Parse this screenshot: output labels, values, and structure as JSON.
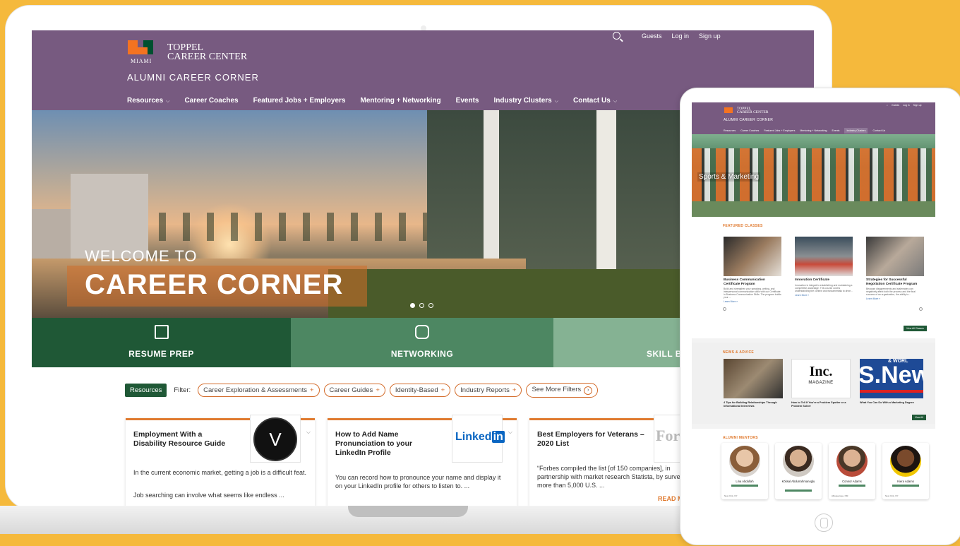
{
  "brand": {
    "logo_miami": "MIAMI",
    "logo_line1": "TOPPEL",
    "logo_line2": "CAREER CENTER",
    "site_subtitle": "ALUMNI CAREER CORNER",
    "colors": {
      "header_purple": "#775a80",
      "green_dark": "#1f5836",
      "orange": "#e07a2f"
    }
  },
  "utility_nav": [
    "Guests",
    "Log in",
    "Sign up"
  ],
  "main_nav": [
    {
      "label": "Resources",
      "dropdown": true
    },
    {
      "label": "Career Coaches",
      "dropdown": false
    },
    {
      "label": "Featured Jobs + Employers",
      "dropdown": false
    },
    {
      "label": "Mentoring + Networking",
      "dropdown": false
    },
    {
      "label": "Events",
      "dropdown": false
    },
    {
      "label": "Industry Clusters",
      "dropdown": true
    },
    {
      "label": "Contact Us",
      "dropdown": true
    }
  ],
  "hero": {
    "welcome": "WELCOME TO",
    "title": "CAREER CORNER",
    "slides": 3,
    "active_slide": 1
  },
  "tiles": [
    {
      "label": "RESUME PREP",
      "icon": "document-icon"
    },
    {
      "label": "NETWORKING",
      "icon": "chat-bubble-icon"
    },
    {
      "label": "SKILL BU",
      "icon": "grid-icon"
    }
  ],
  "filters": {
    "resources_button": "Resources",
    "label": "Filter:",
    "chips": [
      "Career Exploration & Assessments",
      "Career Guides",
      "Identity-Based",
      "Industry Reports"
    ],
    "more": "See More Filters"
  },
  "cards": [
    {
      "title": "Employment With a Disability Resource Guide",
      "body": "In the current economic market, getting a job is a difficult feat.",
      "body2": "Job searching can involve what seems like endless ...",
      "logo": "V"
    },
    {
      "title": "How to Add Name Pronunciation to your LinkedIn Profile",
      "body": "You can record how to pronounce your name and display it on your LinkedIn profile for others to listen to. ...",
      "logo_text": "Linked",
      "logo_in": "in"
    },
    {
      "title": "Best Employers for Veterans – 2020 List",
      "body": "“Forbes compiled the list [of 150 companies], in partnership with market research Statista, by surveying more than 5,000 U.S. ...",
      "logo": "Forb"
    }
  ],
  "read_more": "READ MO",
  "tablet": {
    "logo_line1": "TOPPEL",
    "logo_line2": "CAREER CENTER",
    "subtitle": "ALUMNI CAREER CORNER",
    "utility": [
      "Guests",
      "Log in",
      "Sign up"
    ],
    "nav": [
      "Resources",
      "Career Coaches",
      "Featured Jobs + Employers",
      "Mentoring + Networking",
      "Events",
      "Industry Clusters",
      "Contact Us"
    ],
    "active_nav": "Industry Clusters",
    "hero_label": "Sports & Marketing",
    "featured_title": "FEATURED CLASSES",
    "classes": [
      {
        "name": "Business Communication Certificate Program",
        "desc": "Build and strengthen your speaking, writing, and interpersonal communication skills with our Certificate in Business Communication Skills. The program builds your ...",
        "more": "Learn More »"
      },
      {
        "name": "Innovation Certificate",
        "desc": "Innovation is integral to establishing and maintaining a competitive advantage. This course covers understanding the context and fundamentals to drive...",
        "more": "Learn More »"
      },
      {
        "name": "Strategies for Successful Negotiation Certificate Program",
        "desc": "Because disagreements and stalemates can negatively affect both the process and the final success of an organization, the ability to...",
        "more": "Learn More »"
      }
    ],
    "view_classes": "View All Classes",
    "news_title": "NEWS & ADVICE",
    "news": [
      {
        "caption": "4 Tips for Building Relationships Through Informational Interviews"
      },
      {
        "caption": "How to Tell If You're a Problem Spotter or a Problem Solver",
        "logo": "Inc.",
        "logo_sub": "MAGAZINE"
      },
      {
        "caption": "What You Can Do With a Marketing Degree",
        "logo": "S.New",
        "logo_top": "& WORL"
      }
    ],
    "view_news": "View All",
    "mentors_title": "ALUMNI MENTORS",
    "mentors": [
      {
        "name": "Lina Abdullah",
        "location": "New York, NY"
      },
      {
        "name": "Köksal Abdurrahmanoglu",
        "location": ""
      },
      {
        "name": "Connor Adams",
        "location": "Albuquerque, NM"
      },
      {
        "name": "Kiera Adams",
        "location": "New York, NY"
      }
    ]
  }
}
